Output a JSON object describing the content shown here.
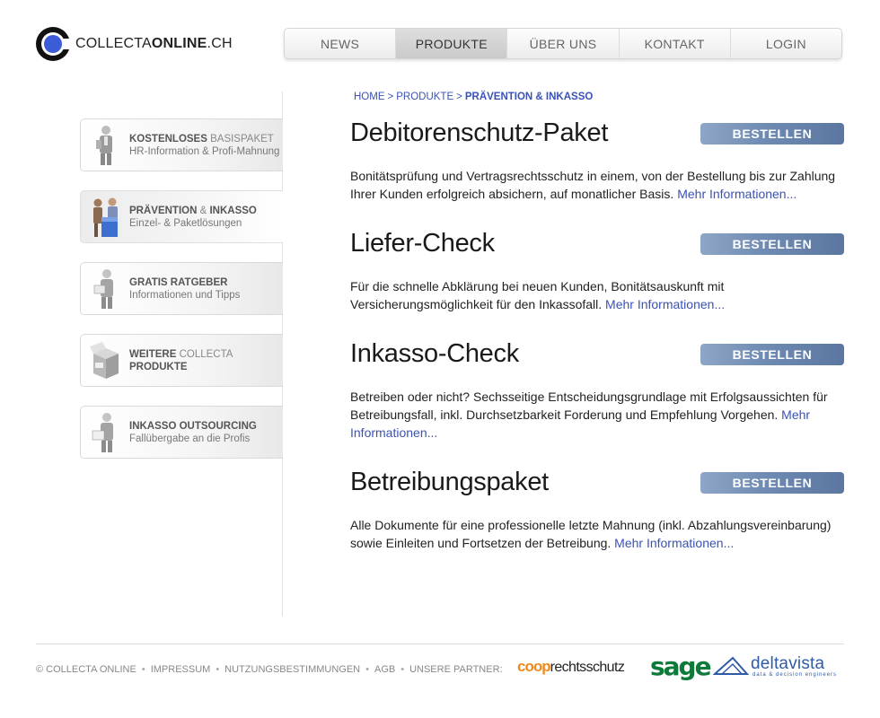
{
  "logo": {
    "prefix": "COLLECTA",
    "bold": "ONLINE",
    "suffix": ".CH"
  },
  "topnav": {
    "items": [
      {
        "label": "NEWS",
        "active": false
      },
      {
        "label": "PRODUKTE",
        "active": true
      },
      {
        "label": "ÜBER UNS",
        "active": false
      },
      {
        "label": "KONTAKT",
        "active": false
      },
      {
        "label": "LOGIN",
        "active": false
      }
    ]
  },
  "sidebar": {
    "items": [
      {
        "title_bold": "KOSTENLOSES",
        "title_rest": " BASISPAKET",
        "subtitle": "HR-Information & Profi-Mahnung",
        "active": false
      },
      {
        "title_bold": "PRÄVENTION",
        "title_mid": " & ",
        "title_bold2": "INKASSO",
        "subtitle": "Einzel- & Paketlösungen",
        "active": true
      },
      {
        "title_bold": "GRATIS RATGEBER",
        "subtitle": "Informationen und Tipps",
        "active": false
      },
      {
        "title_bold": "WEITERE",
        "title_rest": " COLLECTA",
        "title_line2": "PRODUKTE",
        "active": false
      },
      {
        "title_bold": "INKASSO OUTSOURCING",
        "subtitle": "Fallübergabe an die Profis",
        "active": false
      }
    ]
  },
  "breadcrumb": {
    "items": [
      "HOME",
      "PRODUKTE"
    ],
    "separator": ">",
    "current": "PRÄVENTION & INKASSO"
  },
  "products": [
    {
      "title": "Debitorenschutz-Paket",
      "button": "BESTELLEN",
      "text": "Bonitätsprüfung und Vertragsrechtsschutz in einem, von der Bestellung bis zur Zahlung Ihrer Kunden erfolgreich absichern, auf monatlicher Basis.",
      "link": "Mehr Informationen..."
    },
    {
      "title": "Liefer-Check",
      "button": "BESTELLEN",
      "text": "Für die schnelle Abklärung bei neuen Kunden, Bonitätsauskunft mit Versicherungsmöglichkeit für den Inkassofall.",
      "link": "Mehr Informationen..."
    },
    {
      "title": "Inkasso-Check",
      "button": "BESTELLEN",
      "text": "Betreiben oder nicht? Sechsseitige Entscheidungsgrundlage mit Erfolgsaussichten für Betreibungsfall, inkl. Durchsetzbarkeit Forderung und Empfehlung Vorgehen.",
      "link": "Mehr Informationen..."
    },
    {
      "title": "Betreibungspaket",
      "button": "BESTELLEN",
      "text": "Alle Dokumente für eine professionelle letzte Mahnung (inkl. Abzahlungsvereinbarung) sowie Einleiten und Fortsetzen der Betreibung.",
      "link": "Mehr Informationen..."
    }
  ],
  "footer": {
    "copyright": "© COLLECTA ONLINE",
    "links": [
      "IMPRESSUM",
      "NUTZUNGSBESTIMMUNGEN",
      "AGB"
    ],
    "partners_label": "UNSERE PARTNER:",
    "separator": "•",
    "partners": {
      "coop_a": "coop",
      "coop_b": "rechtsschutz",
      "sage": "sage",
      "deltavista": "deltavista",
      "deltavista_sub": "data & decision engineers"
    }
  },
  "colors": {
    "accent_link": "#3a52b8",
    "button": "#6f8bb3",
    "logo_blue": "#3c5bd6"
  }
}
